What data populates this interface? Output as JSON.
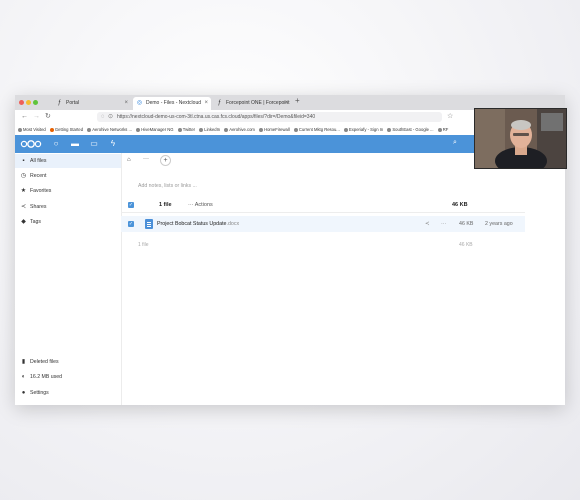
{
  "browser": {
    "tabs": [
      {
        "label": "Portal",
        "icon": "f-icon"
      },
      {
        "label": "Demo - Files - Nextcloud",
        "icon": "nextcloud-icon"
      },
      {
        "label": "Forcepoint ONE | Forcepoint",
        "icon": "f-icon"
      }
    ],
    "new_tab": "+",
    "url": "https://nextcloud-demo-us-com-3tl.ctna.us.cas.fcs.cloud/apps/files/?dir=/Demo&fileid=340",
    "bookmarks": [
      "Most Visited",
      "Getting Started",
      "Aerohive Networks ...",
      "HiveManager NG",
      "Twitter",
      "LinkedIn",
      "Aerohive.com",
      "HomeFirewall",
      "Current Mktg Resou...",
      "Experiafy - Sign In",
      "SouthEast - Google ...",
      "RF"
    ]
  },
  "nextcloud": {
    "header_color": "#4b93d9",
    "apps": [
      "circle-icon",
      "folder-icon",
      "image-icon",
      "bolt-icon"
    ],
    "sidebar": {
      "items": [
        {
          "label": "All files",
          "icon": "folder-icon"
        },
        {
          "label": "Recent",
          "icon": "clock-icon"
        },
        {
          "label": "Favorites",
          "icon": "star-icon"
        },
        {
          "label": "Shares",
          "icon": "share-icon"
        },
        {
          "label": "Tags",
          "icon": "tag-icon"
        }
      ],
      "bottom": [
        {
          "label": "Deleted files",
          "icon": "trash-icon"
        },
        {
          "label": "16.2 MB used",
          "icon": "pie-icon"
        },
        {
          "label": "Settings",
          "icon": "gear-icon"
        }
      ]
    },
    "breadcrumb_more": "···",
    "breadcrumb_add": "+",
    "notes_placeholder": "Add notes, lists or links ...",
    "header_row": {
      "count": "1 file",
      "actions": "Actions",
      "size": "46 KB"
    },
    "files": [
      {
        "name": "Project Bobcat Status Update",
        "ext": ".docx",
        "size": "46 KB",
        "modified": "2 years ago"
      }
    ],
    "summary": {
      "count": "1 file",
      "size": "46 KB"
    }
  }
}
